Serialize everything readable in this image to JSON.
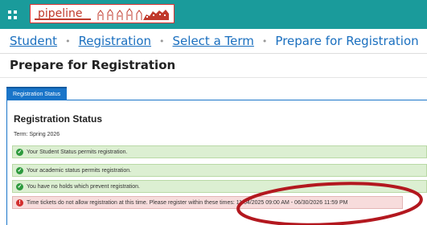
{
  "header": {
    "logo_text": "pipeline"
  },
  "breadcrumb": [
    {
      "label": "Student"
    },
    {
      "label": "Registration"
    },
    {
      "label": "Select a Term"
    },
    {
      "label": "Prepare for Registration"
    }
  ],
  "page_title": "Prepare for Registration",
  "tab_label": "Registration Status",
  "status": {
    "title": "Registration Status",
    "term": "Term: Spring 2026",
    "messages": [
      {
        "type": "success",
        "text": "Your Student Status permits registration."
      },
      {
        "type": "success",
        "text": "Your academic status permits registration."
      },
      {
        "type": "success",
        "text": "You have no holds which prevent registration."
      },
      {
        "type": "error",
        "text": "Time tickets do not allow registration at this time. Please register within these times: 11/04/2025 09:00 AM - 06/30/2026 11:59 PM"
      }
    ]
  },
  "colors": {
    "header_bg": "#1a9b9b",
    "link": "#1a6fbf",
    "tab_bg": "#1a75c9",
    "success_bg": "#dcefd2",
    "error_bg": "#f7dcdc",
    "annotation": "#b3181f"
  }
}
